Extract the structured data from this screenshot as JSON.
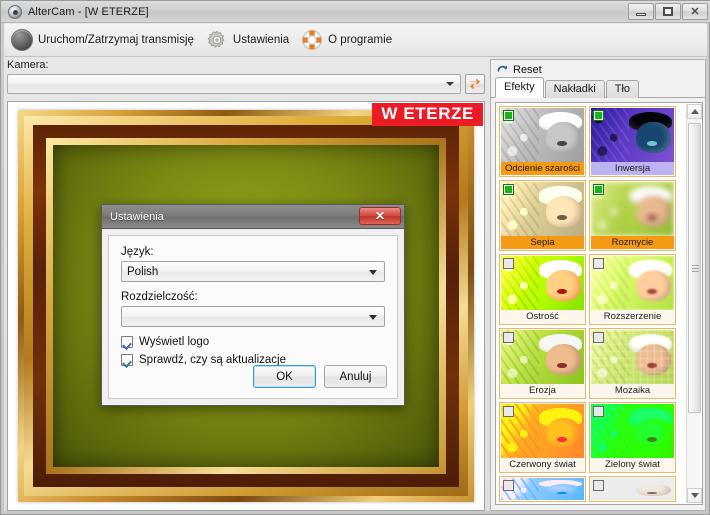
{
  "window": {
    "title": "AlterCam - [W ETERZE]",
    "app_icon": "camera-icon",
    "buttons": {
      "minimize": "minimize-icon",
      "maximize": "maximize-icon",
      "close": "close-icon"
    }
  },
  "toolbar": {
    "items": [
      {
        "icon": "power-button-icon",
        "label": "Uruchom/Zatrzymaj transmisję"
      },
      {
        "icon": "gear-icon",
        "label": "Ustawienia"
      },
      {
        "icon": "lifebuoy-icon",
        "label": "O programie"
      }
    ]
  },
  "camera": {
    "label": "Kamera:",
    "value": "",
    "placeholder": "",
    "refresh_icon": "refresh-icon"
  },
  "preview": {
    "on_air_badge": "W ETERZE",
    "on_air_color": "#ec1b26",
    "overlay_name": "gold-picture-frame"
  },
  "right_panel": {
    "reset": {
      "icon": "reset-arrow-icon",
      "label": "Reset"
    },
    "tabs": [
      {
        "label": "Efekty",
        "active": true
      },
      {
        "label": "Nakładki",
        "active": false
      },
      {
        "label": "Tło",
        "active": false
      }
    ],
    "scrollbar": {
      "up": "scroll-up-icon",
      "down": "scroll-down-icon"
    },
    "effects": [
      {
        "label": "Odcienie szarości",
        "checked": true,
        "highlight": "orange",
        "art": "gray"
      },
      {
        "label": "Inwersja",
        "checked": true,
        "highlight": "lavender",
        "art": "invert"
      },
      {
        "label": "Sepia",
        "checked": true,
        "highlight": "orange",
        "art": "sepia"
      },
      {
        "label": "Rozmycie",
        "checked": true,
        "highlight": "orange",
        "art": "blur"
      },
      {
        "label": "Ostrość",
        "checked": false,
        "highlight": "none",
        "art": "sharp"
      },
      {
        "label": "Rozszerzenie",
        "checked": false,
        "highlight": "none",
        "art": "dilate"
      },
      {
        "label": "Erozja",
        "checked": false,
        "highlight": "none",
        "art": "erode"
      },
      {
        "label": "Mozaika",
        "checked": false,
        "highlight": "none",
        "art": "mosaic"
      },
      {
        "label": "Czerwony świat",
        "checked": false,
        "highlight": "none",
        "art": "redworld"
      },
      {
        "label": "Zielony świat",
        "checked": false,
        "highlight": "none",
        "art": "greenworld"
      },
      {
        "label": "",
        "checked": false,
        "highlight": "none",
        "art": "blueworld"
      },
      {
        "label": "",
        "checked": false,
        "highlight": "none",
        "art": "ghost"
      }
    ]
  },
  "dialog": {
    "title": "Ustawienia",
    "close_label": "✕",
    "language": {
      "label": "Język:",
      "value": "Polish"
    },
    "resolution": {
      "label": "Rozdzielczość:",
      "value": ""
    },
    "checkboxes": [
      {
        "label": "Wyświetl logo",
        "checked": true
      },
      {
        "label": "Sprawdź, czy są aktualizacje",
        "checked": true
      }
    ],
    "ok_label": "OK",
    "cancel_label": "Anuluj"
  }
}
